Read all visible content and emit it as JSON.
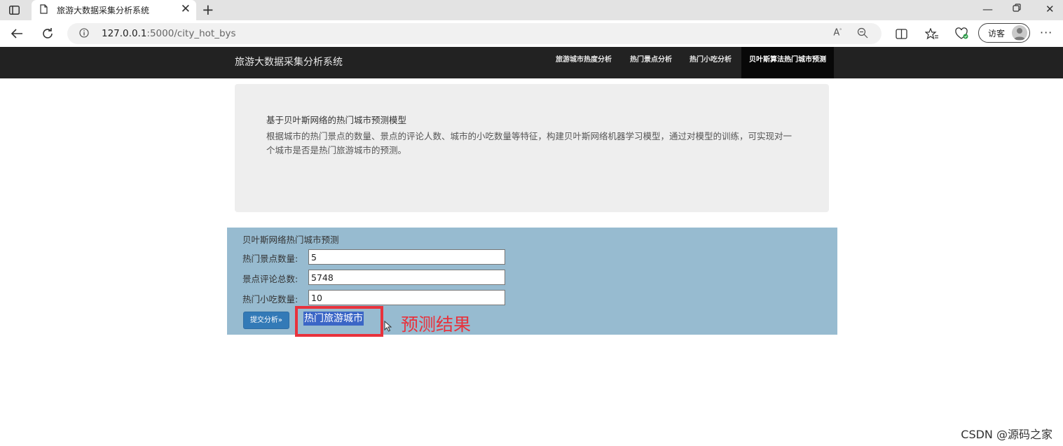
{
  "browser": {
    "tab_title": "旅游大数据采集分析系统",
    "url_host": "127.0.0.1",
    "url_rest": ":5000/city_hot_bys",
    "guest_label": "访客"
  },
  "site": {
    "brand": "旅游大数据采集分析系统",
    "nav": [
      {
        "label": "旅游城市热度分析"
      },
      {
        "label": "热门景点分析"
      },
      {
        "label": "热门小吃分析"
      },
      {
        "label": "贝叶斯算法热门城市预测",
        "active": true
      }
    ]
  },
  "intro": {
    "title": "基于贝叶斯网络的热门城市预测模型",
    "body": "根据城市的热门景点的数量、景点的评论人数、城市的小吃数量等特征，构建贝叶斯网络机器学习模型，通过对模型的训练，可实现对一个城市是否是热门旅游城市的预测。"
  },
  "form": {
    "title": "贝叶斯网络热门城市预测",
    "fields": [
      {
        "label": "热门景点数量:",
        "value": "5"
      },
      {
        "label": "景点评论总数:",
        "value": "5748"
      },
      {
        "label": "热门小吃数量:",
        "value": "10"
      }
    ],
    "submit_label": "提交分析»",
    "result": "热门旅游城市",
    "annotation": "预测结果"
  },
  "watermark": "CSDN @源码之家",
  "colors": {
    "nav_bg": "#222222",
    "panel_bg": "#97bbd0",
    "button": "#337ab7",
    "highlight": "#e8323c"
  }
}
